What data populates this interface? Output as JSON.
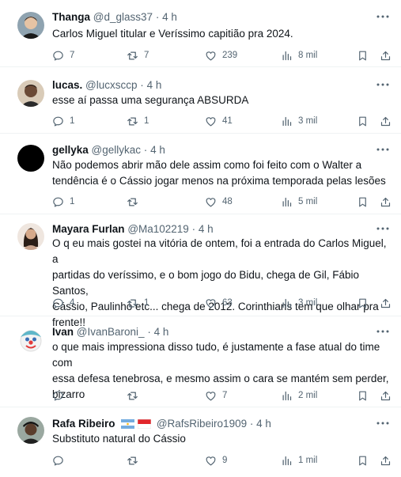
{
  "tweets": [
    {
      "name": "Thanga",
      "handle": "@d_glass37",
      "time": "4 h",
      "text_lines": [
        "Carlos Miguel titular e Veríssimo capitião pra 2024."
      ],
      "replies": "7",
      "retweets": "7",
      "likes": "239",
      "views": "8 mil",
      "avatar": "portrait-light-skin"
    },
    {
      "name": "lucas.",
      "handle": "@lucxsccp",
      "time": "4 h",
      "text_lines": [
        "esse aí passa uma segurança ABSURDA"
      ],
      "replies": "1",
      "retweets": "1",
      "likes": "41",
      "views": "3 mil",
      "avatar": "portrait-dark-skin"
    },
    {
      "name": "gellyka",
      "handle": "@gellykac",
      "time": "4 h",
      "text_lines": [
        "Não podemos abrir mão dele assim como foi feito com o Walter a",
        "tendência é o Cássio jogar menos na próxima temporada pelas lesões"
      ],
      "replies": "1",
      "retweets": "",
      "likes": "48",
      "views": "5 mil",
      "avatar": "black-circle"
    },
    {
      "name": "Mayara Furlan",
      "handle": "@Ma102219",
      "time": "4 h",
      "text_lines": [
        "O q eu mais gostei na vitória de ontem, foi a entrada do Carlos Miguel, a",
        "partidas do veríssimo, e o bom jogo do Bidu, chega de Gil, Fábio Santos,",
        "Cássio, Paulinho etc... chega de 2012. Corinthians tem que olhar pra",
        "frente!!"
      ],
      "replies": "4",
      "retweets": "1",
      "likes": "63",
      "views": "3 mil",
      "avatar": "portrait-woman"
    },
    {
      "name": "Ivan",
      "handle": "@IvanBaroni_",
      "time": "4 h",
      "text_lines": [
        "o que mais impressiona disso tudo, é justamente a fase atual do time com",
        "essa defesa tenebrosa, e mesmo assim o cara se mantém sem perder,",
        "bizarro"
      ],
      "replies": "",
      "retweets": "",
      "likes": "7",
      "views": "2 mil",
      "avatar": "clown"
    },
    {
      "name": "Rafa Ribeiro",
      "handle": "@RafsRibeiro1909",
      "time": "4 h",
      "text_lines": [
        "Substituto natural do Cássio"
      ],
      "replies": "",
      "retweets": "",
      "likes": "9",
      "views": "1 mil",
      "avatar": "portrait-cap",
      "flags": [
        "argentina-flag",
        "indonesia-flag"
      ]
    }
  ],
  "separator": "·",
  "colors": {
    "text": "#0f1419",
    "secondary": "#536471",
    "divider": "#eff3f4"
  },
  "icons": [
    "reply-icon",
    "retweet-icon",
    "like-icon",
    "views-icon",
    "bookmark-icon",
    "share-icon",
    "more-icon"
  ]
}
